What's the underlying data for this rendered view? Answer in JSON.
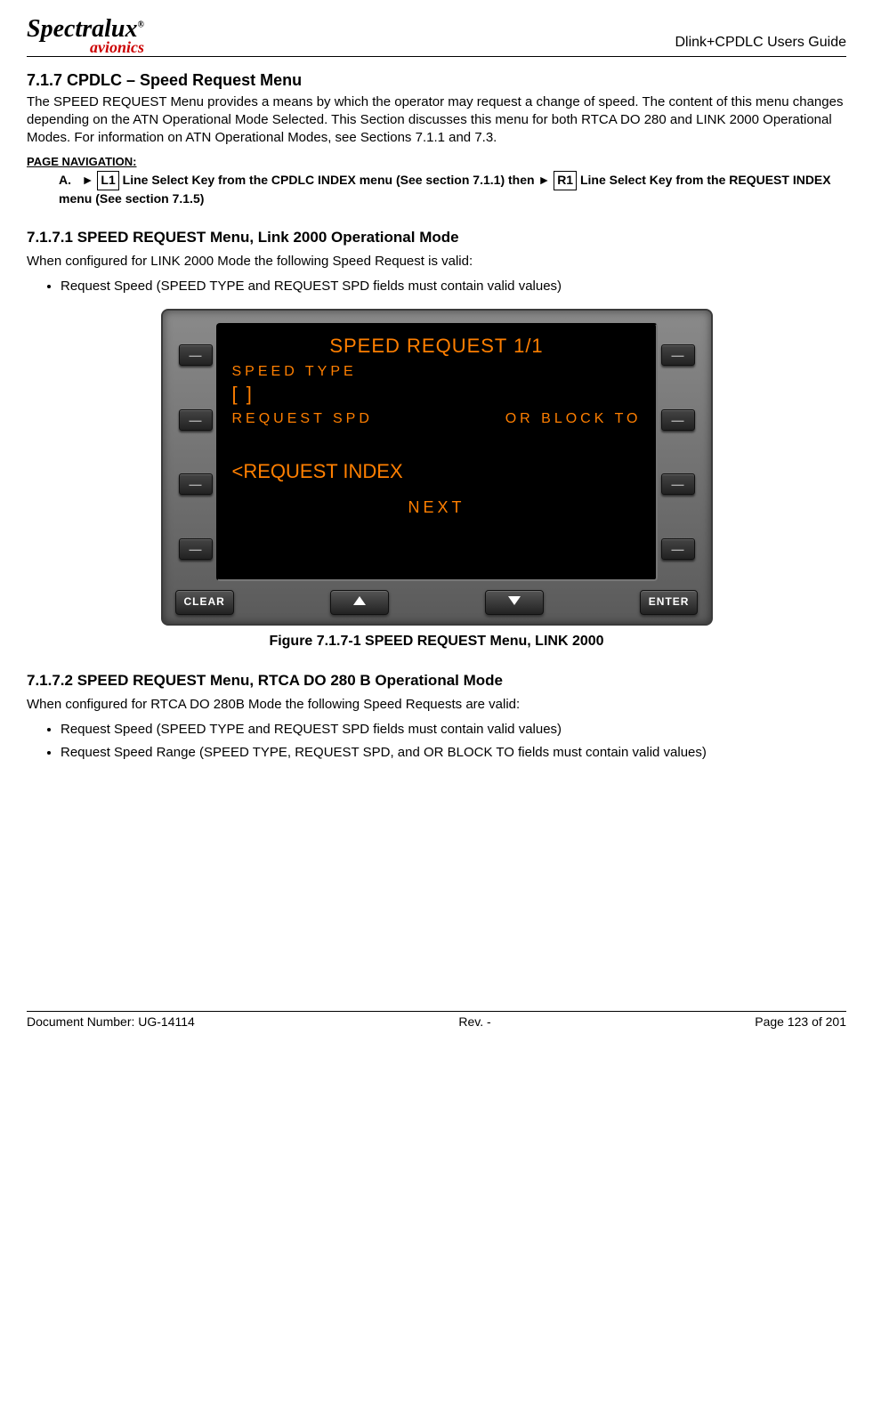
{
  "header": {
    "logo_top": "Spectralux",
    "logo_reg": "®",
    "logo_bottom": "avionics",
    "guide_title": "Dlink+CPDLC Users Guide"
  },
  "section": {
    "heading": "7.1.7   CPDLC – Speed Request Menu",
    "intro": "The SPEED REQUEST Menu provides a means by which the operator may request a change of speed. The content of this menu changes depending on the ATN Operational Mode Selected. This Section discusses this menu for both RTCA DO 280 and LINK 2000 Operational Modes. For information on ATN Operational Modes, see Sections 7.1.1 and 7.3.",
    "nav_header": "PAGE NAVIGATION:",
    "nav": {
      "label": "A.",
      "arrow1": "►",
      "key1": "L1",
      "text1": " Line Select Key from the CPDLC INDEX menu (See section 7.1.1) then ",
      "arrow2": "►",
      "key2": "R1",
      "text2": " Line Select Key from the REQUEST INDEX menu (See section 7.1.5)"
    }
  },
  "sub1": {
    "heading": "7.1.7.1  SPEED REQUEST Menu, Link 2000 Operational Mode",
    "intro": "When configured for LINK 2000 Mode the following Speed Request is valid:",
    "bullets": [
      "Request Speed (SPEED TYPE and REQUEST SPD fields must contain valid values)"
    ]
  },
  "device": {
    "screen": {
      "title": "SPEED REQUEST  1/1",
      "row1_label": "SPEED TYPE",
      "row1_value": "[   ]",
      "row2_left": "REQUEST SPD",
      "row2_right": "OR BLOCK TO",
      "link": "<REQUEST INDEX",
      "next": "NEXT"
    },
    "buttons": {
      "clear": "CLEAR",
      "enter": "ENTER"
    }
  },
  "figure_caption": "Figure 7.1.7-1 SPEED REQUEST Menu, LINK 2000",
  "sub2": {
    "heading": "7.1.7.2  SPEED REQUEST Menu, RTCA DO 280 B Operational Mode",
    "intro": "When configured for RTCA DO 280B Mode the following Speed Requests are valid:",
    "bullets": [
      "Request Speed (SPEED TYPE and REQUEST SPD fields must contain valid values)",
      "Request Speed Range (SPEED TYPE, REQUEST SPD, and OR BLOCK TO fields must contain valid values)"
    ]
  },
  "footer": {
    "doc": "Document Number:  UG-14114",
    "rev": "Rev. -",
    "page": "Page 123 of 201"
  }
}
